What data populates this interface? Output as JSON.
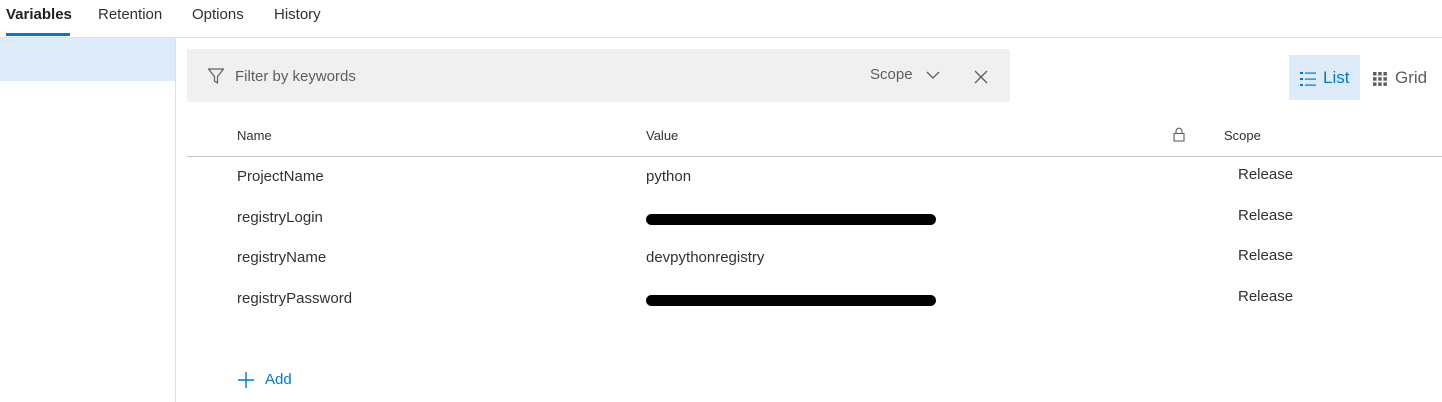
{
  "tabs": [
    {
      "label": "Variables",
      "active": true
    },
    {
      "label": "Retention",
      "active": false
    },
    {
      "label": "Options",
      "active": false
    },
    {
      "label": "History",
      "active": false
    }
  ],
  "filter": {
    "placeholder": "Filter by keywords",
    "value": "",
    "scope_label": "Scope"
  },
  "view": {
    "list_label": "List",
    "grid_label": "Grid",
    "selected": "List"
  },
  "table": {
    "columns": {
      "name": "Name",
      "value": "Value",
      "scope": "Scope"
    },
    "rows": [
      {
        "name": "ProjectName",
        "value": "python",
        "scope": "Release",
        "redacted": false
      },
      {
        "name": "registryLogin",
        "value": "",
        "scope": "Release",
        "redacted": true
      },
      {
        "name": "registryName",
        "value": "devpythonregistry",
        "scope": "Release",
        "redacted": false
      },
      {
        "name": "registryPassword",
        "value": "",
        "scope": "Release",
        "redacted": true
      }
    ]
  },
  "add_label": "Add",
  "colors": {
    "accent": "#0078d4",
    "selected_bg": "#deecf9",
    "filter_bg": "#f0f0f0"
  },
  "icons": [
    "filter-icon",
    "chevron-down-icon",
    "close-icon",
    "list-icon",
    "grid-icon",
    "lock-icon",
    "plus-icon"
  ]
}
